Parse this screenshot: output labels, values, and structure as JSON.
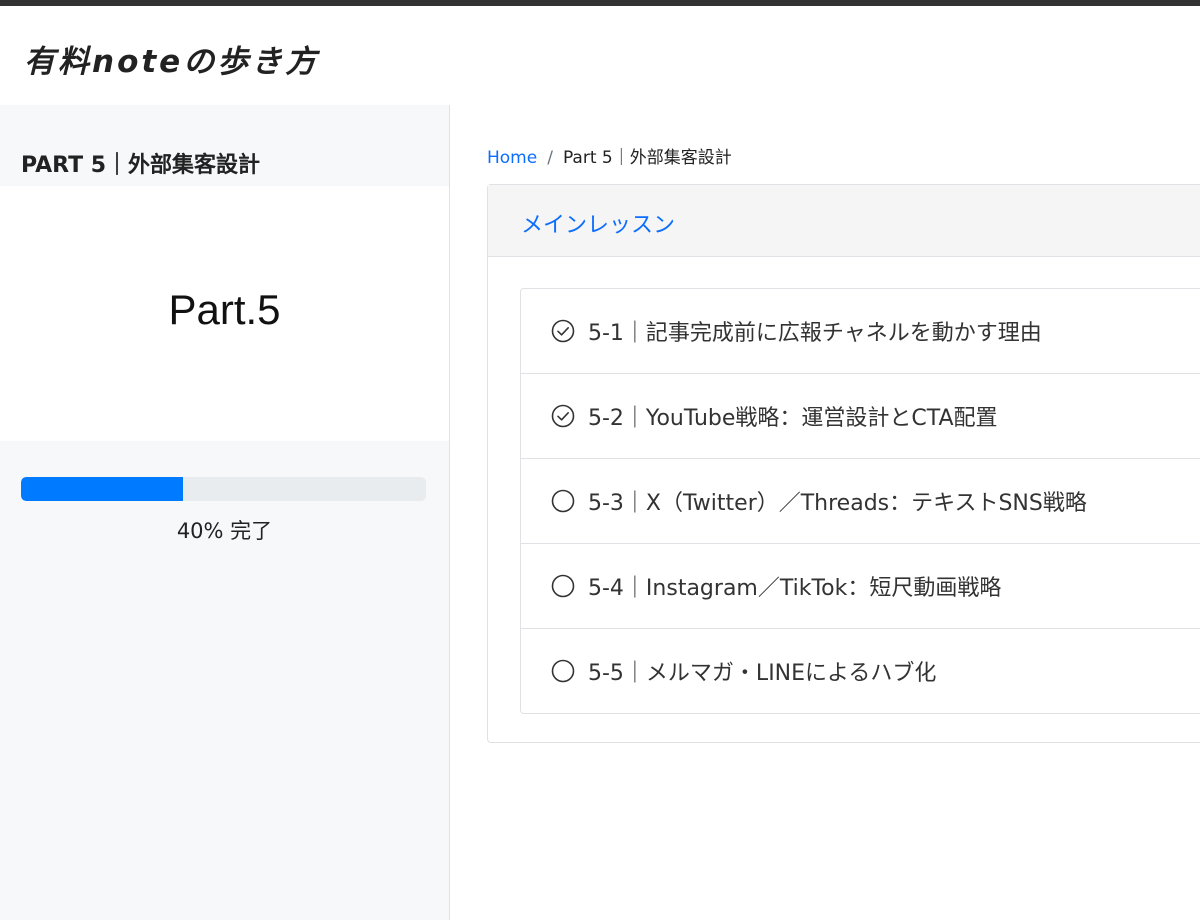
{
  "header": {
    "logo_text": "有料noteの歩き方"
  },
  "sidebar": {
    "title": "PART 5｜外部集客設計",
    "part_label": "Part.5",
    "progress": {
      "percent": 40,
      "text": "40% 完了",
      "fill_color": "#007bff",
      "track_color": "#e9ecef"
    }
  },
  "breadcrumb": {
    "home": "Home",
    "separator": "/",
    "current": "Part 5｜外部集客設計"
  },
  "main": {
    "card_title": "メインレッスン",
    "lessons": [
      {
        "title": "5-1｜記事完成前に広報チャネルを動かす理由",
        "completed": true,
        "icon": "check-circle-icon"
      },
      {
        "title": "5-2｜YouTube戦略：運営設計とCTA配置",
        "completed": true,
        "icon": "check-circle-icon"
      },
      {
        "title": "5-3｜X（Twitter）／Threads：テキストSNS戦略",
        "completed": false,
        "icon": "empty-circle-icon"
      },
      {
        "title": "5-4｜Instagram／TikTok：短尺動画戦略",
        "completed": false,
        "icon": "empty-circle-icon"
      },
      {
        "title": "5-5｜メルマガ・LINEによるハブ化",
        "completed": false,
        "icon": "empty-circle-icon"
      }
    ]
  },
  "colors": {
    "accent": "#0d6efd",
    "topbar": "#333333",
    "sidebar_bg": "#f7f8fa"
  }
}
